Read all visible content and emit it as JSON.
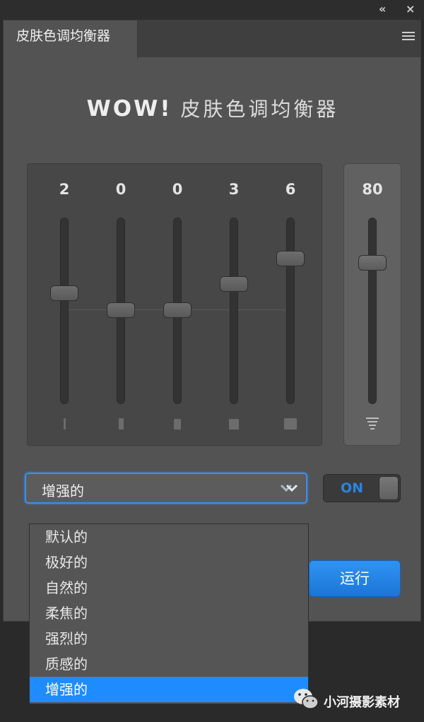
{
  "window": {
    "collapse_glyph": "«",
    "close_glyph": "×"
  },
  "panel": {
    "tab_title": "皮肤色调均衡器",
    "menu_icon": "hamburger-menu-icon",
    "heading_bold": "WOW!",
    "heading_text": "皮肤色调均衡器"
  },
  "equalizer": {
    "sliders": [
      {
        "label": "2",
        "value": 2
      },
      {
        "label": "0",
        "value": 0
      },
      {
        "label": "0",
        "value": 0
      },
      {
        "label": "3",
        "value": 3
      },
      {
        "label": "6",
        "value": 6
      }
    ],
    "range": [
      -10,
      10
    ],
    "master": {
      "label": "80",
      "value": 80,
      "range": [
        0,
        100
      ]
    }
  },
  "preset": {
    "selected": "增强的",
    "options": [
      "默认的",
      "极好的",
      "自然的",
      "柔焦的",
      "强烈的",
      "质感的",
      "增强的"
    ],
    "selected_index": 6
  },
  "toggle": {
    "label": "ON",
    "state": true
  },
  "run_button": {
    "label": "运行"
  },
  "footer": {
    "brand": "小河摄影素材",
    "icon": "wechat-icon"
  },
  "colors": {
    "accent": "#1e8cff",
    "panel": "#535353"
  }
}
